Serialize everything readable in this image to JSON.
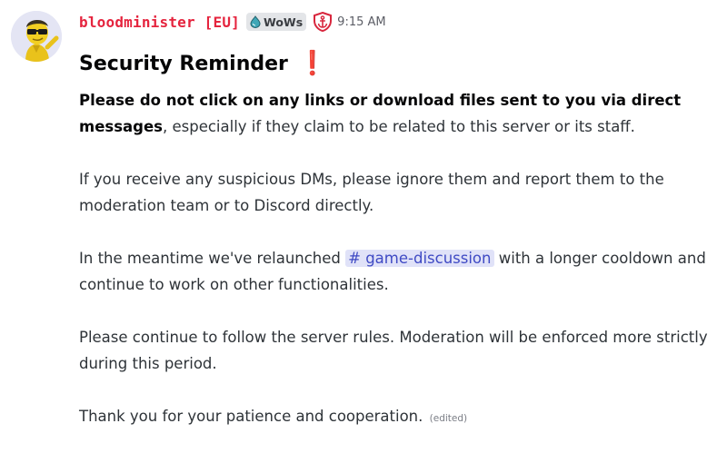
{
  "message": {
    "author": "bloodminister [EU]",
    "server_tag": "WoWs",
    "timestamp": "9:15 AM",
    "heading": "Security Reminder",
    "heading_emoji": "❗",
    "paragraphs": {
      "p1_bold": "Please do not click on any links or download files sent to you via direct messages",
      "p1_rest": ", especially if they claim to be related to this server or its staff.",
      "p2": "If you receive any suspicious DMs, please ignore them and report them to the moderation team or to Discord directly.",
      "p3_before": "In the meantime we've relaunched ",
      "p3_channel": "# game-discussion",
      "p3_after": " with a longer cooldown and continue to work on other functionalities.",
      "p4": "Please continue to follow the server rules. Moderation will be enforced more strictly during this period.",
      "p5": "Thank you for your patience and cooperation.",
      "edited": "(edited)"
    }
  },
  "colors": {
    "username": "#e5243e",
    "mention_bg": "#e0e2f8",
    "mention_text": "#3f4ac4",
    "role_icon": "#d8263d"
  },
  "icons": {
    "avatar": "yellow-character-with-sunglasses-avatar",
    "server_tag": "drop-icon",
    "role": "shield-anchor-icon"
  }
}
